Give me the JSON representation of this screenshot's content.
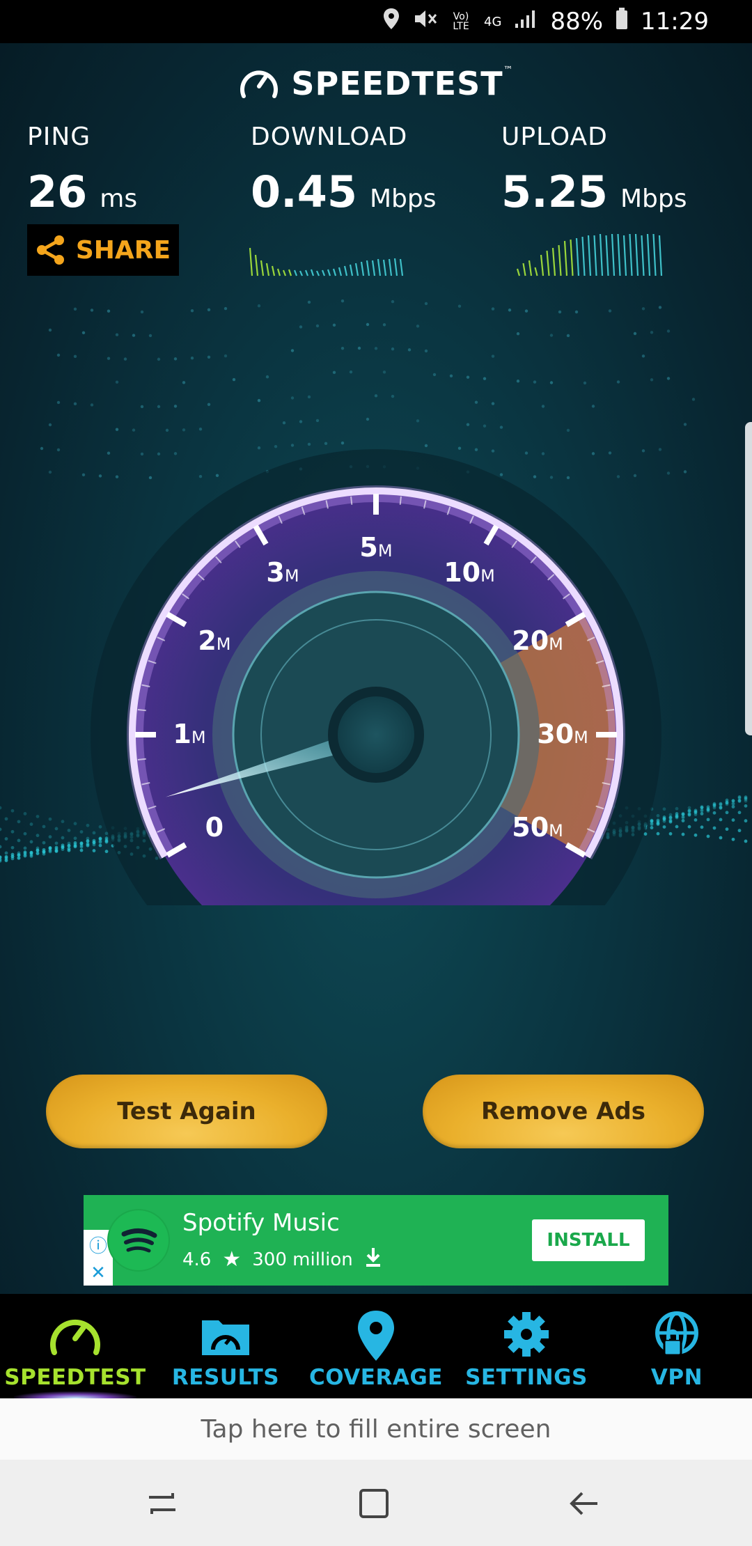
{
  "status_bar": {
    "icons": [
      "location-icon",
      "mute-icon",
      "volte-icon",
      "4g-icon",
      "signal-icon"
    ],
    "volte": "Vo) LTE",
    "network": "4G",
    "battery": "88%",
    "time": "11:29"
  },
  "header": {
    "logo_text": "SPEEDTEST",
    "trademark": "™"
  },
  "metrics": {
    "ping": {
      "label": "PING",
      "value": "26",
      "unit": "ms"
    },
    "download": {
      "label": "DOWNLOAD",
      "value": "0.45",
      "unit": "Mbps"
    },
    "upload": {
      "label": "UPLOAD",
      "value": "5.25",
      "unit": "Mbps"
    }
  },
  "share": {
    "label": "SHARE"
  },
  "gauge": {
    "ticks": [
      {
        "num": "0",
        "unit": ""
      },
      {
        "num": "1",
        "unit": "M"
      },
      {
        "num": "2",
        "unit": "M"
      },
      {
        "num": "3",
        "unit": "M"
      },
      {
        "num": "5",
        "unit": "M"
      },
      {
        "num": "10",
        "unit": "M"
      },
      {
        "num": "20",
        "unit": "M"
      },
      {
        "num": "30",
        "unit": "M"
      },
      {
        "num": "50",
        "unit": "M"
      }
    ],
    "needle_value_mbps": 0.45
  },
  "buttons": {
    "test_again": "Test Again",
    "remove_ads": "Remove Ads"
  },
  "ad": {
    "title": "Spotify Music",
    "rating": "4.6",
    "installs": "300 million",
    "install_label": "INSTALL"
  },
  "nav": {
    "items": [
      {
        "label": "SPEEDTEST",
        "icon": "speedometer-icon",
        "active": true
      },
      {
        "label": "RESULTS",
        "icon": "results-folder-icon",
        "active": false
      },
      {
        "label": "COVERAGE",
        "icon": "map-pin-icon",
        "active": false
      },
      {
        "label": "SETTINGS",
        "icon": "gear-icon",
        "active": false
      },
      {
        "label": "VPN",
        "icon": "vpn-globe-lock-icon",
        "active": false
      }
    ],
    "active_color": "#a6e22e",
    "inactive_color": "#27b6e3"
  },
  "fill_bar": {
    "text": "Tap here to fill entire screen"
  },
  "colors": {
    "accent_gold": "#f4a51c",
    "ad_green": "#1fb254"
  }
}
